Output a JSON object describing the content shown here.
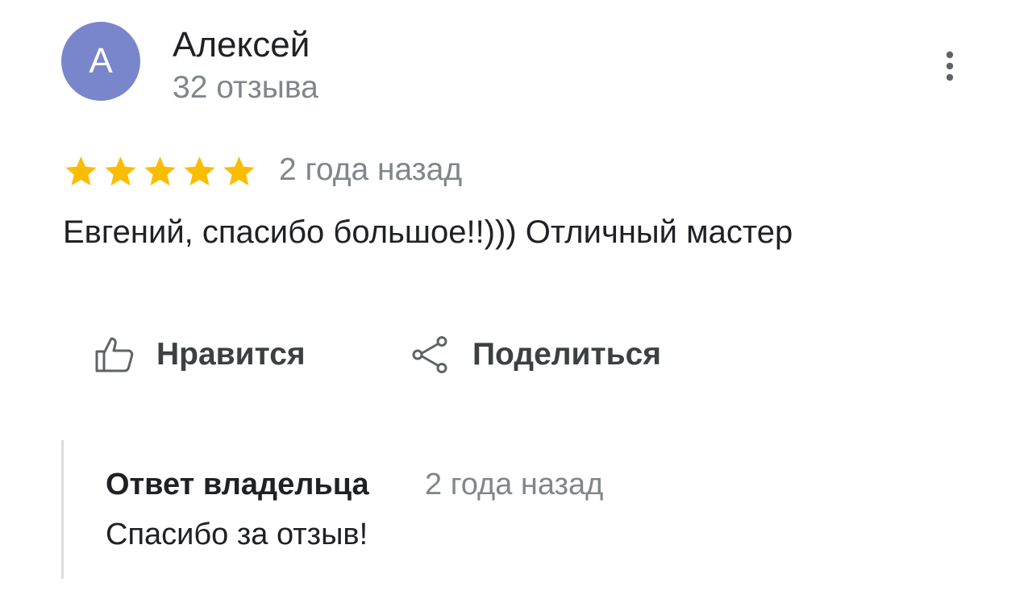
{
  "review": {
    "author": {
      "initial": "А",
      "name": "Алексей",
      "reviews_count": "32 отзыва",
      "avatar_color": "#7986cb"
    },
    "rating": {
      "value": 5,
      "max": 5,
      "star_color": "#fbbc04"
    },
    "date": "2 года назад",
    "text": "Евгений, спасибо большое!!))) Отличный мастер",
    "menu_icon": "more-vert-icon"
  },
  "actions": {
    "like": {
      "label": "Нравится",
      "icon": "thumb-up-icon"
    },
    "share": {
      "label": "Поделиться",
      "icon": "share-icon"
    }
  },
  "owner_response": {
    "title": "Ответ владельца",
    "date": "2 года назад",
    "text": "Спасибо за отзыв!"
  }
}
